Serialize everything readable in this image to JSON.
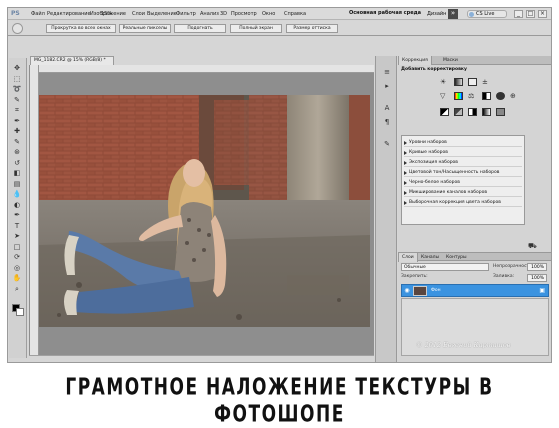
{
  "app": {
    "logo": "PS",
    "menu": [
      "Файл",
      "Редактирование",
      "Изображение",
      "Слои",
      "Выделение",
      "Фильтр",
      "Анализ",
      "3D",
      "Просмотр",
      "Окно",
      "Справка"
    ],
    "zoom": "15%",
    "workspace": "Основная рабочая среда",
    "design": "Дизайн",
    "more": "»",
    "cslive": "CS Live"
  },
  "options": {
    "scroll_all": "Прокрутка во всех окнах",
    "actual_pixels": "Реальные пикселы",
    "fit_screen": "Подогнать",
    "full_screen": "Полный экран",
    "print_size": "Размер оттиска"
  },
  "document": {
    "tab": "MG_1182.CR2 @ 15% (RGB/8) *"
  },
  "adjustments": {
    "tabs": [
      "Коррекция",
      "Маски"
    ],
    "title": "Добавить корректировку",
    "presets": [
      "Уровни наборов",
      "Кривые наборов",
      "Экспозиция наборов",
      "Цветовой тон/Насыщенность наборов",
      "Черно-белое наборов",
      "Микширование каналов наборов",
      "Выборочная коррекция цвета наборов"
    ]
  },
  "layers": {
    "tabs": [
      "Слои",
      "Каналы",
      "Контуры"
    ],
    "blend_mode": "Обычные",
    "opacity_label": "Непрозрачность:",
    "opacity": "100%",
    "lock_label": "Закрепить:",
    "fill_label": "Заливка:",
    "fill": "100%",
    "layer_name": "Фон"
  },
  "watermark": "© 2012 Евгений Карташов",
  "caption": "ГРАМОТНОЕ НАЛОЖЕНИЕ ТЕКСТУРЫ В ФОТОШОПЕ",
  "colors": {
    "selection": "#3b93e0",
    "chrome": "#d6d6d6"
  }
}
